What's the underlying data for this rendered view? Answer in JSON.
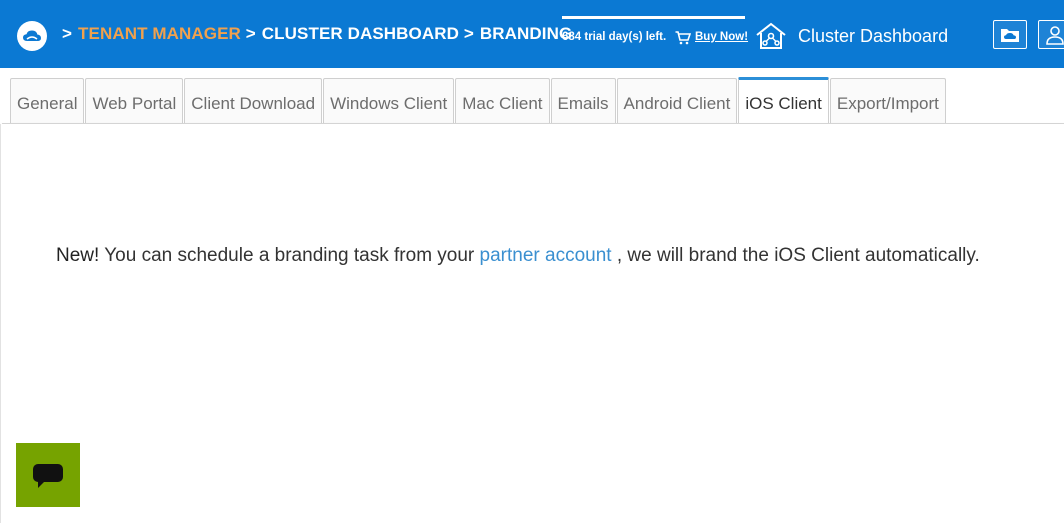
{
  "header": {
    "breadcrumb": {
      "sep": ">",
      "items": [
        {
          "label": "TENANT MANAGER",
          "type": "link"
        },
        {
          "label": "CLUSTER DASHBOARD",
          "type": "text"
        },
        {
          "label": "BRANDING",
          "type": "text"
        }
      ]
    },
    "trial": {
      "text": "684 trial day(s) left.",
      "buy_label": "Buy Now!"
    },
    "dashboard_title": "Cluster Dashboard"
  },
  "tabs": [
    {
      "label": "General",
      "active": false
    },
    {
      "label": "Web Portal",
      "active": false
    },
    {
      "label": "Client Download",
      "active": false
    },
    {
      "label": "Windows Client",
      "active": false
    },
    {
      "label": "Mac Client",
      "active": false
    },
    {
      "label": "Emails",
      "active": false
    },
    {
      "label": "Android Client",
      "active": false
    },
    {
      "label": "iOS Client",
      "active": true
    },
    {
      "label": "Export/Import",
      "active": false
    }
  ],
  "message": {
    "prefix": "New!",
    "text1": " You can schedule a branding task from your ",
    "link": "partner account",
    "text2": " , we will brand the iOS Client automatically."
  },
  "colors": {
    "header_bg": "#0b79d3",
    "breadcrumb_link": "#f0a14e",
    "active_tab_border": "#2b8fd8",
    "link": "#3a8fd0",
    "chat_button": "#76a300"
  },
  "icons": {
    "logo": "cloud-logo-icon",
    "cart": "shopping-cart-icon",
    "dashboard": "house-network-icon",
    "header_btn_1": "cloud-folder-icon",
    "header_btn_2": "user-icon",
    "chat": "chat-bubble-icon"
  }
}
